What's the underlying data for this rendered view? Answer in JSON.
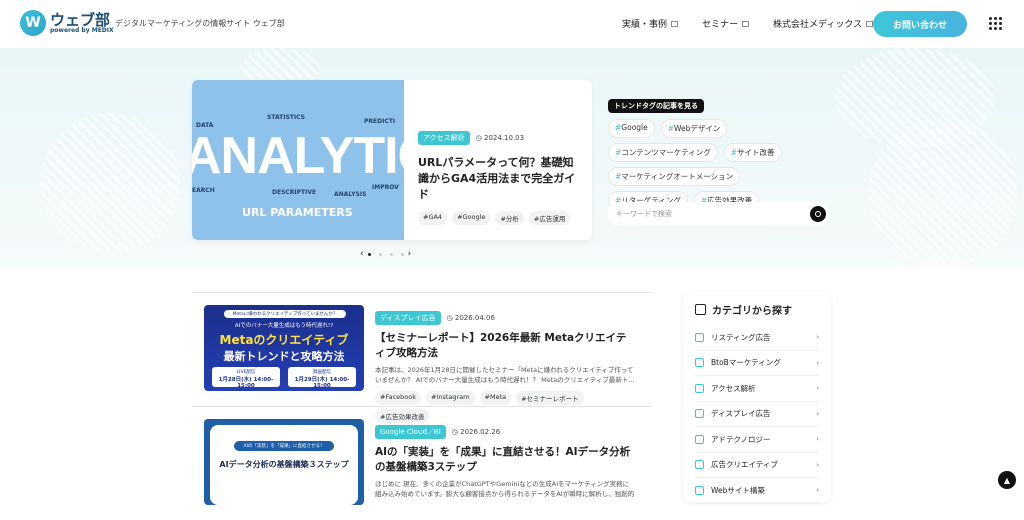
{
  "header": {
    "logo_mark": "W",
    "logo_name": "ウェブ部",
    "logo_sub": "powered by MEDIX",
    "tagline": "デジタルマーケティングの情報サイト ウェブ部",
    "nav": [
      "実績・事例",
      "セミナー",
      "株式会社メディックス"
    ],
    "cta": "お問い合わせ"
  },
  "featured": {
    "badge": "アクセス解析",
    "date": "2024.10.03",
    "title": "URLパラメータって何？基礎知識からGA4活用法まで完全ガイド",
    "tags": [
      "#GA4",
      "#Google",
      "#分析",
      "#広告運用"
    ],
    "image_text": {
      "big": "ANALYTICS",
      "url": "URL PARAMETERS",
      "words": [
        "STATISTICS",
        "DATA",
        "PREDICTI",
        "DESCRIPTIVE",
        "EARCH",
        "ANALYSIS",
        "IMPROV"
      ]
    },
    "slider": {
      "prev": "‹",
      "next": "›",
      "count": 4,
      "active": 0
    }
  },
  "trend": {
    "heading": "トレンドタグの記事を見る",
    "tags": [
      "Google",
      "Webデザイン",
      "コンテンツマーケティング",
      "サイト改善",
      "マーケティングオートメーション",
      "リターゲティング",
      "広告効果改善"
    ]
  },
  "search": {
    "placeholder": "キーワードで検索"
  },
  "articles": [
    {
      "badge": "ディスプレイ広告",
      "date": "2026.04.06",
      "title": "【セミナーレポート】2026年最新 Metaクリエイティブ攻略方法",
      "excerpt": "本記事は、2026年1月28日に開催したセミナー「Metaに嫌われるクリエイティブ作っていませんか？ AIでのバナー大量生成はもう時代遅れ！？ Metaのクリエイティブ最新ト…",
      "tags": [
        "#Facebook",
        "#Instagram",
        "#Meta",
        "#セミナーレポート",
        "#広告効果改善"
      ],
      "thumb": {
        "line1": "Metaに嫌われるクリエイティブ作っていませんか？",
        "line2": "AIでのバナー大量生成はもう時代遅れ!?",
        "big1": "Metaのクリエイティブ",
        "big2": "最新トレンドと攻略方法",
        "d1": "1月28日(水) 14:00-15:00",
        "d2": "1月29日(木) 14:00-15:00",
        "live": "LIVE配信",
        "rec": "録画配信"
      }
    },
    {
      "badge": "Google Cloud／BI",
      "date": "2026.02.26",
      "title": "AIの「実装」を「成果」に直結させる！AIデータ分析の基盤構築3ステップ",
      "excerpt": "はじめに 現在、多くの企業がChatGPTやGeminiなどの生成AIをマーケティング実務に組み込み始めています。膨大な顧客接点から得られるデータをAIが瞬時に解析し、独創的な…",
      "tags": [],
      "thumb": {
        "line1": "AIの「実装」を「成果」に直結させる！",
        "big": "AIデータ分析の基盤構築３ステップ"
      }
    }
  ],
  "categories": {
    "heading": "カテゴリから探す",
    "items": [
      "リスティング広告",
      "BtoBマーケティング",
      "アクセス解析",
      "ディスプレイ広告",
      "アドテクノロジー",
      "広告クリエイティブ",
      "Webサイト構築"
    ]
  },
  "colors": {
    "accent": "#3cc7d3",
    "dark": "#1a4f77"
  }
}
